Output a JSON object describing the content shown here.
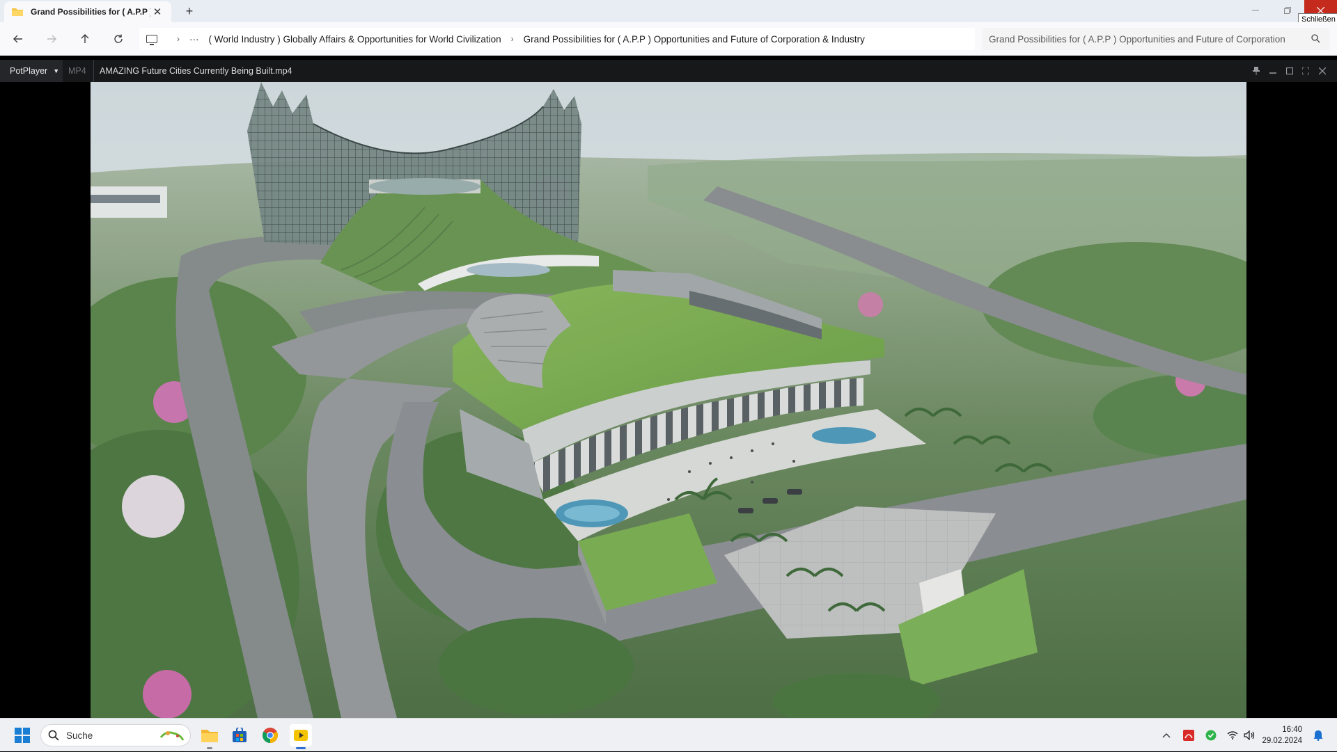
{
  "explorer": {
    "tab_title": "Grand Possibilities for ( A.P.P )",
    "close_tooltip": "Schließen",
    "breadcrumbs": [
      "( World Industry ) Globally Affairs & Opportunities for World Civilization",
      "Grand Possibilities for ( A.P.P ) Opportunities and Future of Corporation & Industry"
    ],
    "search_placeholder": "Grand Possibilities for ( A.P.P ) Opportunities and Future of Corporation"
  },
  "player": {
    "brand": "PotPlayer",
    "format": "MP4",
    "filename": "AMAZING Future Cities Currently Being Built.mp4"
  },
  "taskbar": {
    "search_label": "Suche",
    "time": "16:40",
    "date": "29.02.2024",
    "pinned": [
      "start-icon",
      "file-explorer-icon",
      "microsoft-store-icon",
      "chrome-icon",
      "potplayer-icon"
    ]
  },
  "colors": {
    "close_red": "#c42b1c",
    "player_bar": "#17181a",
    "taskbar": "#eef0f4"
  }
}
